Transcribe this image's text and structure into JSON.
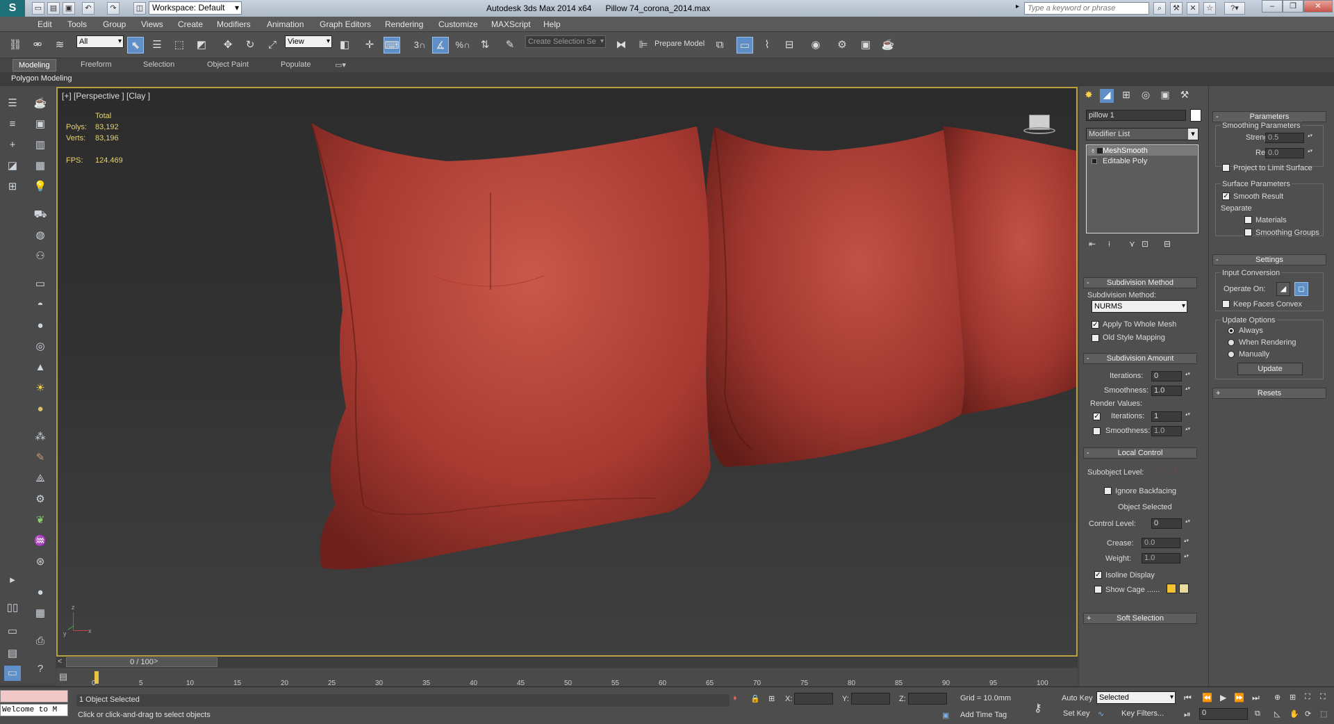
{
  "titlebar": {
    "workspace": "Workspace: Default",
    "app": "Autodesk 3ds Max  2014 x64",
    "file": "Pillow 74_corona_2014.max",
    "search_placeholder": "Type a keyword or phrase"
  },
  "menu": [
    "Edit",
    "Tools",
    "Group",
    "Views",
    "Create",
    "Modifiers",
    "Animation",
    "Graph Editors",
    "Rendering",
    "Customize",
    "MAXScript",
    "Help"
  ],
  "toolbar": {
    "selection_filter": "All",
    "ref_coord": "View",
    "named_selection": "Create Selection Se",
    "prepare_model": "Prepare Model",
    "snap_3": "3",
    "snap_pct": "%"
  },
  "ribbon": {
    "tabs": [
      "Modeling",
      "Freeform",
      "Selection",
      "Object Paint",
      "Populate"
    ],
    "panel": "Polygon Modeling"
  },
  "viewport": {
    "label": "[+] [Perspective ] [Clay ]",
    "stats": {
      "total": "Total",
      "polys_label": "Polys:",
      "polys": "83,192",
      "verts_label": "Verts:",
      "verts": "83,196",
      "fps_label": "FPS:",
      "fps": "124.469"
    },
    "axis": {
      "x": "x",
      "y": "y",
      "z": "z"
    },
    "colors": {
      "pillow": "#b5453a",
      "stats": "#e8d36a",
      "border": "#b9a040"
    }
  },
  "timeline": {
    "frame": "0 / 100",
    "ticks": [
      "0",
      "5",
      "10",
      "15",
      "20",
      "25",
      "30",
      "35",
      "40",
      "45",
      "50",
      "55",
      "60",
      "65",
      "70",
      "75",
      "80",
      "85",
      "90",
      "95",
      "100"
    ]
  },
  "status": {
    "selected": "1 Object Selected",
    "hint": "Click or click-and-drag to select objects",
    "maxscript": "Welcome to M",
    "x_label": "X:",
    "y_label": "Y:",
    "z_label": "Z:",
    "grid": "Grid = 10.0mm",
    "add_time_tag": "Add Time Tag",
    "auto_key": "Auto Key",
    "set_key": "Set Key",
    "key_mode": "Selected",
    "key_filters": "Key Filters...",
    "frame": "0"
  },
  "modify": {
    "object_name": "pillow 1",
    "modifier_list": "Modifier List",
    "stack": [
      "MeshSmooth",
      "Editable Poly"
    ]
  },
  "subdivision_method": {
    "header": "Subdivision Method",
    "method_label": "Subdivision Method:",
    "method": "NURMS",
    "apply_whole": "Apply To Whole Mesh",
    "old_style": "Old Style Mapping"
  },
  "subdivision_amount": {
    "header": "Subdivision Amount",
    "iterations_label": "Iterations:",
    "iterations": "0",
    "smoothness_label": "Smoothness:",
    "smoothness": "1.0",
    "render_values": "Render Values:",
    "r_iterations_label": "Iterations:",
    "r_iterations": "1",
    "r_smoothness_label": "Smoothness:",
    "r_smoothness": "1.0"
  },
  "local_control": {
    "header": "Local Control",
    "subobject": "Subobject Level:",
    "ignore_backfacing": "Ignore Backfacing",
    "object_selected": "Object Selected",
    "control_level_label": "Control Level:",
    "control_level": "0",
    "crease_label": "Crease:",
    "crease": "0.0",
    "weight_label": "Weight:",
    "weight": "1.0",
    "isoline": "Isoline Display",
    "show_cage": "Show Cage ......",
    "cage_colors": [
      "#f2c232",
      "#e8dc9a"
    ]
  },
  "soft_selection": {
    "header": "Soft Selection"
  },
  "parameters": {
    "header": "Parameters",
    "smoothing_params": "Smoothing Parameters",
    "strength_label": "Strength:",
    "strength": "0.5",
    "relax_label": "Relax:",
    "relax": "0.0",
    "project_limit": "Project to Limit Surface",
    "surface_params": "Surface Parameters",
    "smooth_result": "Smooth Result",
    "separate": "Separate",
    "materials": "Materials",
    "smoothing_groups": "Smoothing Groups"
  },
  "settings": {
    "header": "Settings",
    "input_conversion": "Input Conversion",
    "operate_on": "Operate On:",
    "keep_faces": "Keep Faces Convex",
    "update_options": "Update Options",
    "always": "Always",
    "when_rendering": "When Rendering",
    "manually": "Manually",
    "update": "Update"
  },
  "resets": {
    "header": "Resets"
  }
}
